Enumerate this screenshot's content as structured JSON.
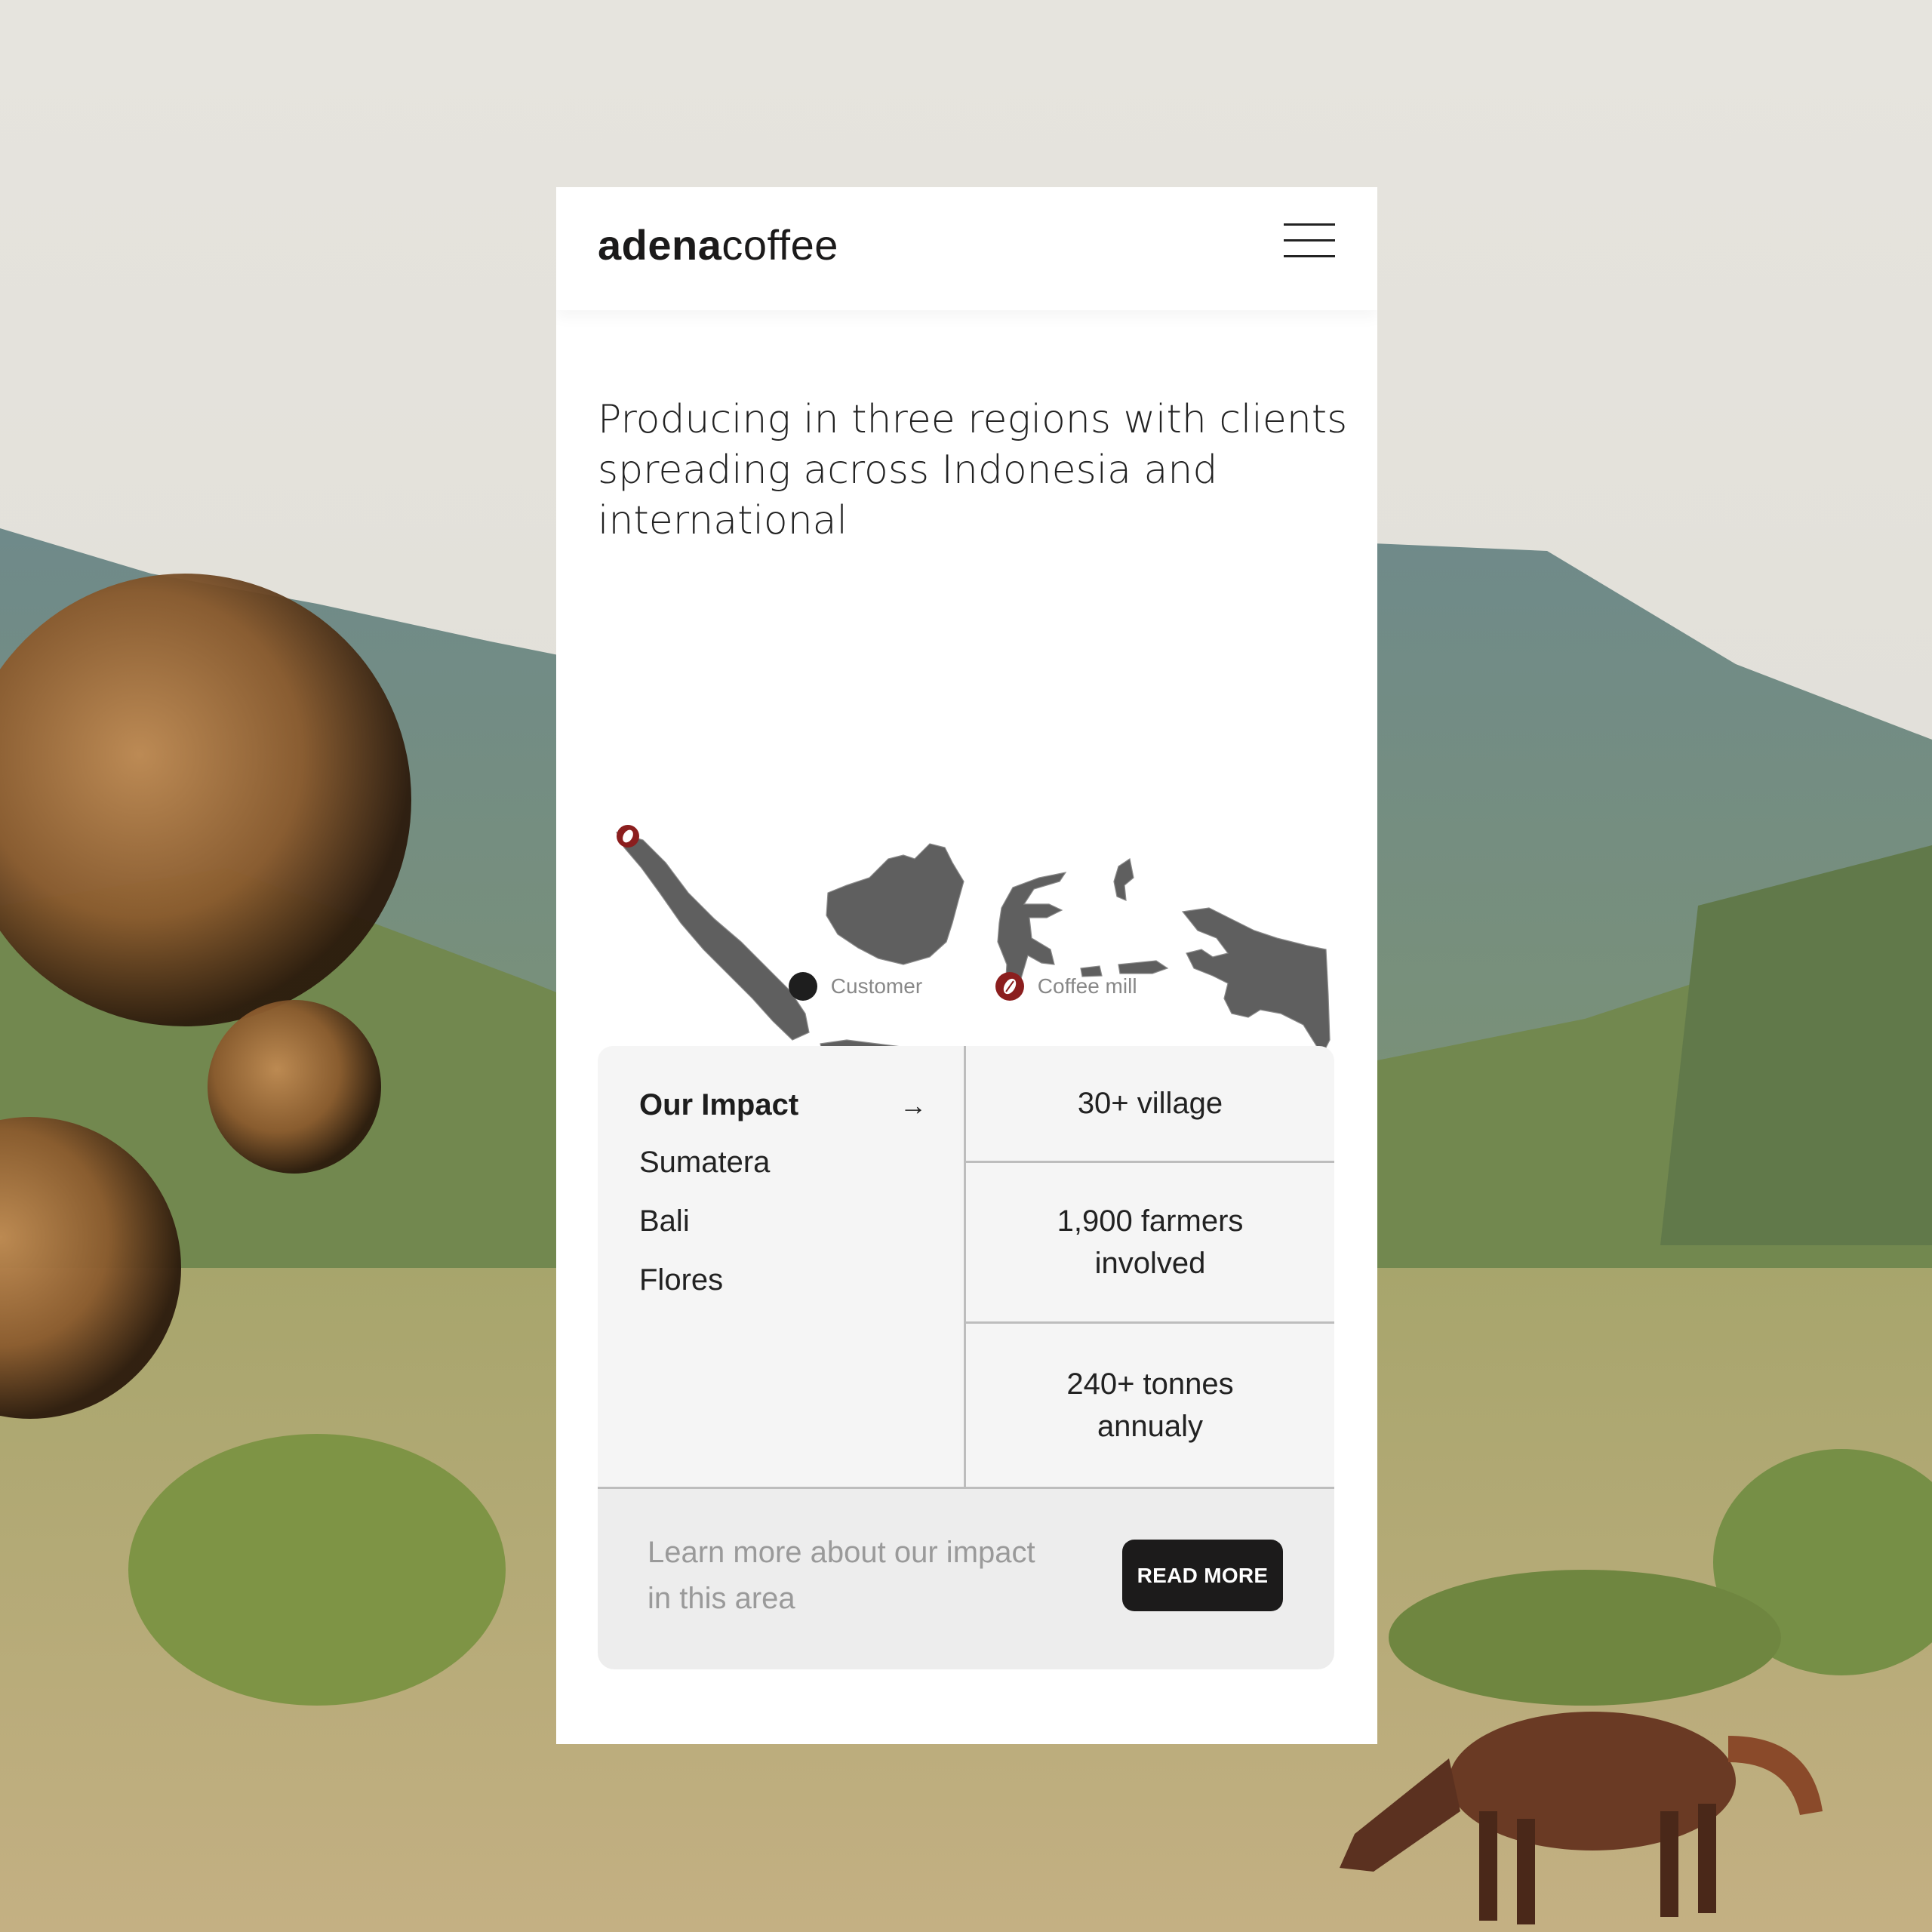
{
  "brand": {
    "bold": "adena",
    "light": "coffee"
  },
  "headline": "Producing in three regions with clients spreading across Indonesia and international",
  "legend": {
    "customer": "Customer",
    "coffee_mill": "Coffee mill"
  },
  "impact": {
    "title": "Our Impact",
    "regions": [
      "Sumatera",
      "Bali",
      "Flores"
    ],
    "stats": [
      "30+ village",
      "1,900 farmers involved",
      "240+ tonnes annualy"
    ]
  },
  "cta": {
    "text": "Learn more about our impact in this area",
    "button": "READ MORE"
  },
  "colors": {
    "accent": "#8b1e1e",
    "map": "#5f5f5f",
    "dark": "#1c1b1b"
  },
  "icons": {
    "menu": "hamburger-menu-icon",
    "arrow": "arrow-right-icon",
    "mill": "coffee-bean-icon"
  }
}
